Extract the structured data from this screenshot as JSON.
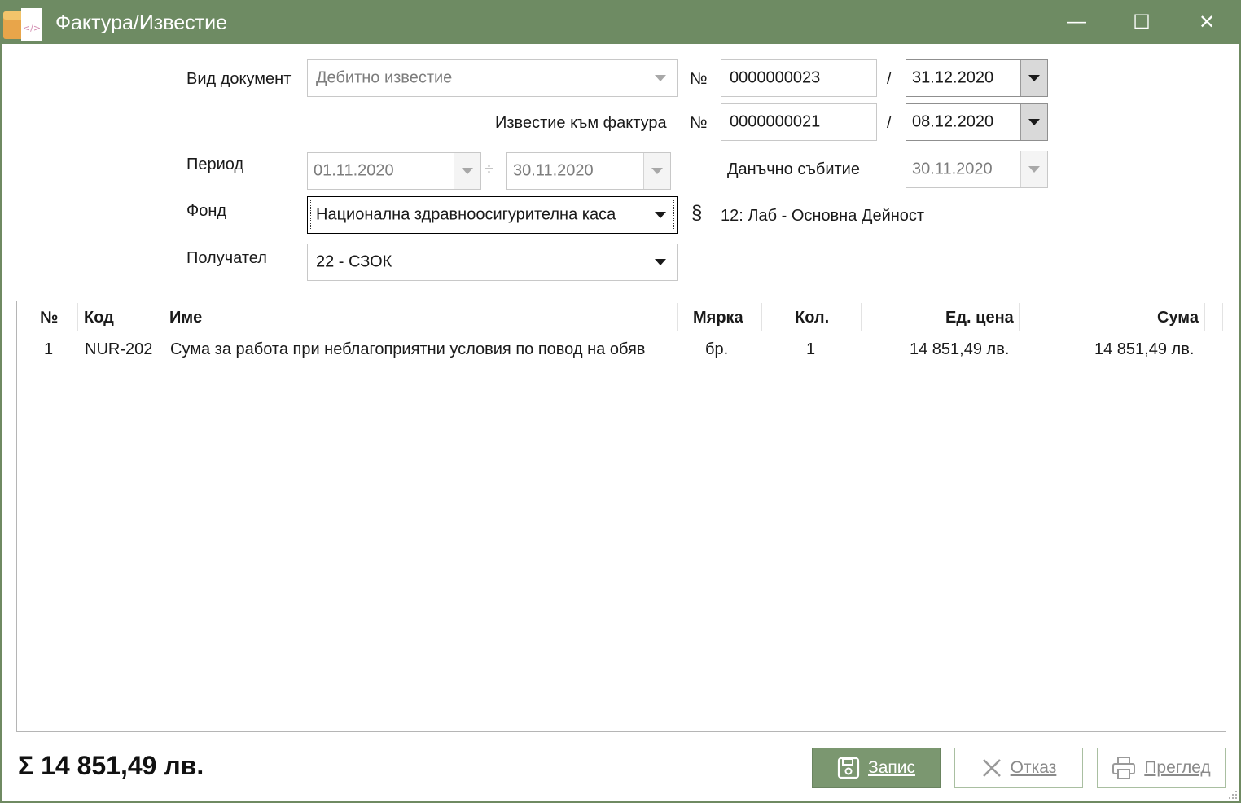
{
  "window": {
    "title": "Фактура/Известие",
    "controls": {
      "minimize": "—",
      "maximize": "☐",
      "close": "✕"
    }
  },
  "form": {
    "doc_type_label": "Вид документ",
    "doc_type_value": "Дебитно известие",
    "number_sign": "№",
    "number_sign2": "№",
    "slash": "/",
    "slash2": "/",
    "doc_number": "0000000023",
    "doc_date": "31.12.2020",
    "invoice_ref_label": "Известие към фактура",
    "invoice_number": "0000000021",
    "invoice_date": "08.12.2020",
    "period_label": "Период",
    "period_from": "01.11.2020",
    "period_sep": "÷",
    "period_to": "30.11.2020",
    "tax_event_label": "Данъчно събитие",
    "tax_event_date": "30.11.2020",
    "fund_label": "Фонд",
    "fund_value": "Национална здравноосигурителна каса",
    "paragraph_sign": "§",
    "paragraph_value": "12: Лаб - Основна Дейност",
    "recipient_label": "Получател",
    "recipient_value": "22 - СЗОК"
  },
  "grid": {
    "columns": [
      "№",
      "Код",
      "Име",
      "Мярка",
      "Кол.",
      "Ед. цена",
      "Сума"
    ],
    "rows": [
      {
        "no": "1",
        "code": "NUR-202",
        "name": "Сума за работа при неблагоприятни условия по повод на обяв",
        "unit": "бр.",
        "qty": "1",
        "unit_price": "14 851,49 лв.",
        "sum": "14 851,49 лв."
      }
    ]
  },
  "footer": {
    "sigma": "Σ",
    "total": "14 851,49 лв.",
    "save_label": "Запис",
    "cancel_label": "Отказ",
    "preview_label": "Преглед"
  },
  "icons": {
    "app": "app-icon",
    "save": "floppy-disk-icon",
    "cancel": "x-icon",
    "preview": "printer-icon"
  },
  "colors": {
    "titlebar": "#6e8b63",
    "primary_button": "#7b9770",
    "secondary_border": "#a9bfa1"
  }
}
